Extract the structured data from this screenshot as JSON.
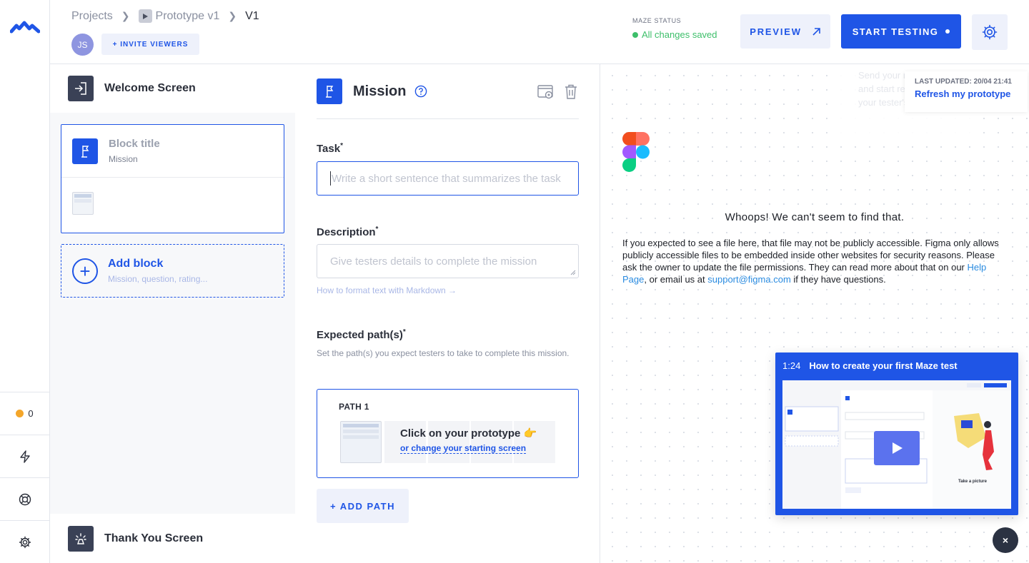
{
  "header": {
    "breadcrumb": [
      "Projects",
      "Prototype v1",
      "V1"
    ],
    "avatar_initials": "JS",
    "invite_label": "+ INVITE VIEWERS",
    "status_label": "MAZE STATUS",
    "status_value": "All changes saved",
    "preview_label": "PREVIEW",
    "start_label": "START TESTING"
  },
  "rail": {
    "notification_count": "0",
    "icons": [
      "maze-logo-icon",
      "bolt-icon",
      "lifebuoy-icon",
      "gear-icon"
    ]
  },
  "blocks": {
    "welcome": "Welcome Screen",
    "block_title": "Block title",
    "block_subtitle": "Mission",
    "add_title": "Add block",
    "add_subtitle": "Mission, question, rating...",
    "thanks": "Thank You Screen"
  },
  "editor": {
    "title": "Mission",
    "task_label": "Task",
    "task_placeholder": "Write a short sentence that summarizes the task",
    "description_label": "Description",
    "description_placeholder": "Give testers details to complete the mission",
    "markdown_link": "How to format text with Markdown →",
    "paths_label": "Expected path(s)",
    "paths_help": "Set the path(s) you expect testers to take to complete this mission.",
    "path_name": "PATH 1",
    "path_click": "Click on your prototype 👉",
    "path_change": "or change your starting screen",
    "add_path": "+ ADD PATH",
    "required_mark": "*"
  },
  "preview": {
    "ghost_tip": "Send your maze live and start recording your tester's session!",
    "last_updated": "LAST UPDATED: 20/04 21:41",
    "refresh": "Refresh my prototype",
    "whoops": "Whoops! We can't seem to find that.",
    "error_1": "If you expected to see a file here, that file may not be publicly accessible. Figma only allows publicly accessible files to be embedded inside other websites for security reasons. Please ask the owner to update the file permissions. They can read more about that on our ",
    "help_link": "Help Page",
    "error_2": ", or email us at ",
    "email_link": "support@figma.com",
    "error_3": " if they have questions."
  },
  "video": {
    "time": "1:24",
    "title": "How to create your first Maze test",
    "close": "×"
  },
  "colors": {
    "accent": "#1f55e6",
    "saved_green": "#3dbf6a",
    "notification_dot": "#f4a62a"
  }
}
